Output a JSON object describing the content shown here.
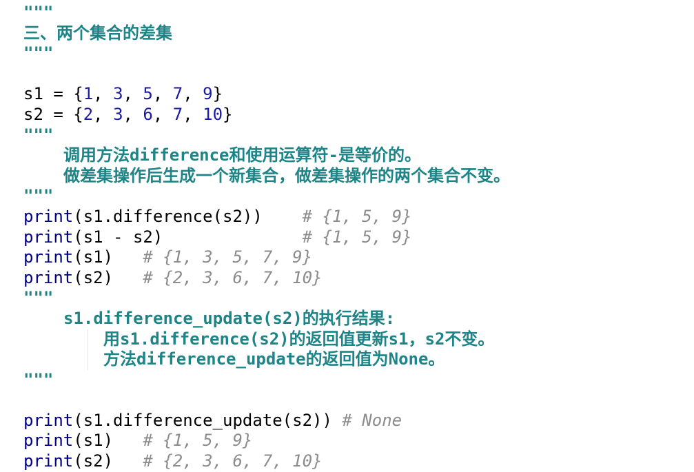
{
  "colors": {
    "docstring": "#1d8487",
    "number": "#1a1aa6",
    "builtin": "#000080",
    "comment": "#8c8c8c",
    "text": "#000000"
  },
  "code": {
    "doc1_open": "\"\"\"",
    "doc1_title": "三、两个集合的差集",
    "doc1_close": "\"\"\"",
    "s1_prefix": "s1 = {",
    "s1_values": [
      "1",
      "3",
      "5",
      "7",
      "9"
    ],
    "s2_prefix": "s2 = {",
    "s2_values": [
      "2",
      "3",
      "6",
      "7",
      "10"
    ],
    "sep": ", ",
    "brace_close": "}",
    "doc2_open": "\"\"\"",
    "doc2_line1": "调用方法difference和使用运算符-是等价的。",
    "doc2_line2": "做差集操作后生成一个新集合，做差集操作的两个集合不变。",
    "doc2_close": "\"\"\"",
    "print_kw": "print",
    "p1_args": "(s1.difference(s2))    ",
    "p1_comment": "# {1, 5, 9}",
    "p2_args": "(s1 - s2)              ",
    "p2_comment": "# {1, 5, 9}",
    "p3_args": "(s1)   ",
    "p3_comment": "# {1, 3, 5, 7, 9}",
    "p4_args": "(s2)   ",
    "p4_comment": "# {2, 3, 6, 7, 10}",
    "doc3_open": "\"\"\"",
    "doc3_line1": "s1.difference_update(s2)的执行结果:",
    "doc3_line2": "用s1.difference(s2)的返回值更新s1，s2不变。",
    "doc3_line3": "方法difference_update的返回值为None。",
    "doc3_close": "\"\"\"",
    "p5_args": "(s1.difference_update(s2)) ",
    "p5_comment": "# None",
    "p6_args": "(s1)   ",
    "p6_comment": "# {1, 5, 9}",
    "p7_args": "(s2)   ",
    "p7_comment": "# {2, 3, 6, 7, 10}"
  }
}
